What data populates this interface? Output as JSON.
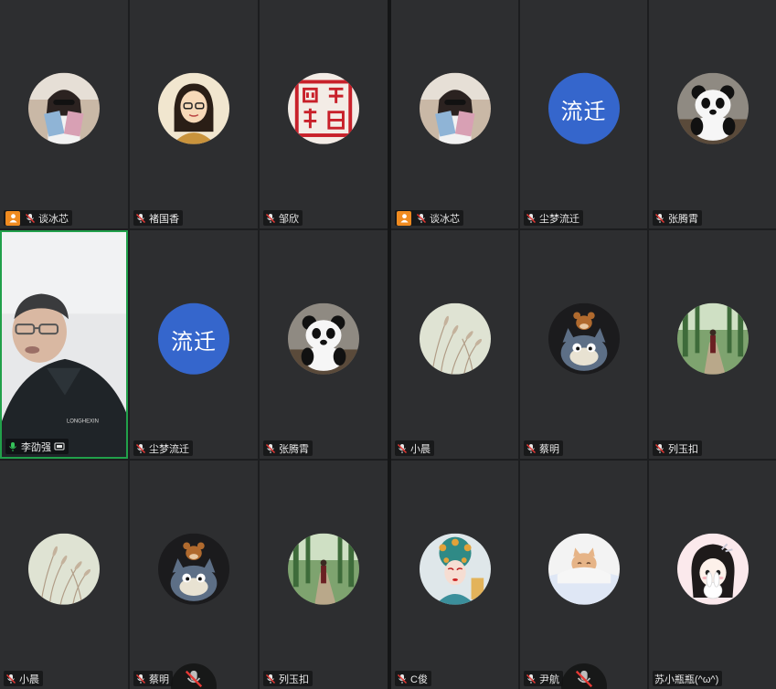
{
  "colors": {
    "tile_bg": "#2d2e30",
    "speaking_border": "#21a04a",
    "host_badge": "#f08b20",
    "text_avatar": "#3566cc"
  },
  "left_grid": [
    {
      "name": "谈冰芯",
      "avatar": "photo-selfie",
      "host": true,
      "mic": "muted-red"
    },
    {
      "name": "褚国香",
      "avatar": "cartoon-woman",
      "host": false,
      "mic": "muted-red"
    },
    {
      "name": "邹欣",
      "avatar": "red-seal",
      "host": false,
      "mic": "muted-red"
    },
    {
      "name": "李劭强",
      "avatar": "live-video",
      "host": false,
      "mic": "speaking-green",
      "speaking": true
    },
    {
      "name": "尘梦流迁",
      "avatar": "text",
      "avatar_text": "流迁",
      "host": false,
      "mic": "muted-red"
    },
    {
      "name": "张腾霄",
      "avatar": "panda",
      "host": false,
      "mic": "muted-red"
    },
    {
      "name": "小晨",
      "avatar": "grass",
      "host": false,
      "mic": "muted-red"
    },
    {
      "name": "蔡明",
      "avatar": "tom-jerry",
      "host": false,
      "mic": "muted-red"
    },
    {
      "name": "列玉扣",
      "avatar": "forest-path",
      "host": false,
      "mic": "muted-red"
    }
  ],
  "right_grid": [
    {
      "name": "谈冰芯",
      "avatar": "photo-selfie",
      "host": true,
      "mic": "muted-red"
    },
    {
      "name": "尘梦流迁",
      "avatar": "text",
      "avatar_text": "流迁",
      "host": false,
      "mic": "muted-red"
    },
    {
      "name": "张腾霄",
      "avatar": "panda",
      "host": false,
      "mic": "muted-red"
    },
    {
      "name": "小晨",
      "avatar": "grass",
      "host": false,
      "mic": "muted-red"
    },
    {
      "name": "蔡明",
      "avatar": "tom-jerry",
      "host": false,
      "mic": "muted-red"
    },
    {
      "name": "列玉扣",
      "avatar": "forest-path",
      "host": false,
      "mic": "muted-red"
    },
    {
      "name": "C俊",
      "avatar": "opera-mask",
      "host": false,
      "mic": "muted-red"
    },
    {
      "name": "尹航",
      "avatar": "cat-blanket",
      "host": false,
      "mic": "muted-red"
    },
    {
      "name": "苏小瓶瓶(^ω^)",
      "avatar": "girl-bunny",
      "host": false,
      "mic": "none"
    }
  ],
  "mute_buttons": [
    {
      "label": "mute-mic"
    },
    {
      "label": "mute-mic"
    }
  ]
}
